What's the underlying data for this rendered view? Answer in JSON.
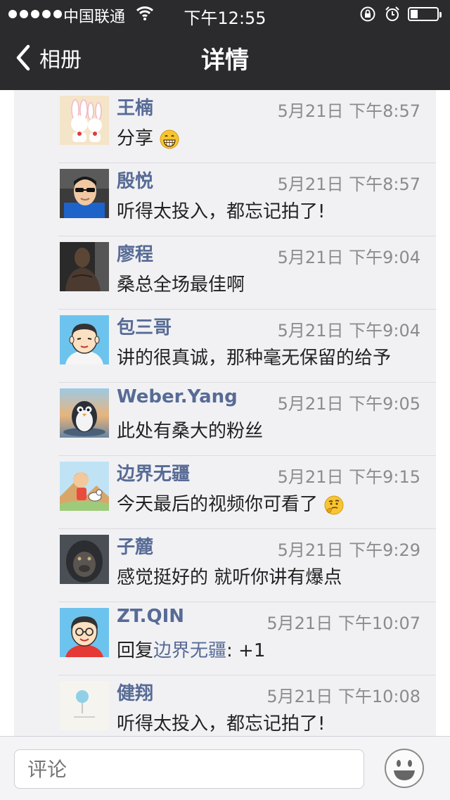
{
  "status_bar": {
    "carrier": "中国联通",
    "time": "下午12:55"
  },
  "nav": {
    "back_label": "相册",
    "title": "详情"
  },
  "comments": [
    {
      "name": "王楠",
      "time": "5月21日 下午8:57",
      "text": "分享",
      "emoji": "grinning-face"
    },
    {
      "name": "殷悦",
      "time": "5月21日 下午8:57",
      "text": "听得太投入，都忘记拍了!"
    },
    {
      "name": "廖程",
      "time": "5月21日 下午9:04",
      "text": "桑总全场最佳啊"
    },
    {
      "name": "包三哥",
      "time": "5月21日 下午9:04",
      "text": "讲的很真诚，那种毫无保留的给予"
    },
    {
      "name": "Weber.Yang",
      "time": "5月21日 下午9:05",
      "text": "此处有桑大的粉丝"
    },
    {
      "name": "边界无疆",
      "time": "5月21日 下午9:15",
      "text": "今天最后的视频你可看了",
      "emoji": "thinking-face"
    },
    {
      "name": "子麓",
      "time": "5月21日 下午9:29",
      "text": "感觉挺好的 就听你讲有爆点"
    },
    {
      "name": "ZT.QIN",
      "time": "5月21日 下午10:07",
      "reply_prefix": "回复",
      "reply_to": "边界无疆",
      "text": ": +1"
    },
    {
      "name": "健翔",
      "time": "5月21日 下午10:08",
      "text": "听得太投入，都忘记拍了!"
    }
  ],
  "input": {
    "placeholder": "评论"
  },
  "colors": {
    "name": "#576b95",
    "header": "#2b2b2e",
    "list_bg": "#f1f1f4"
  }
}
